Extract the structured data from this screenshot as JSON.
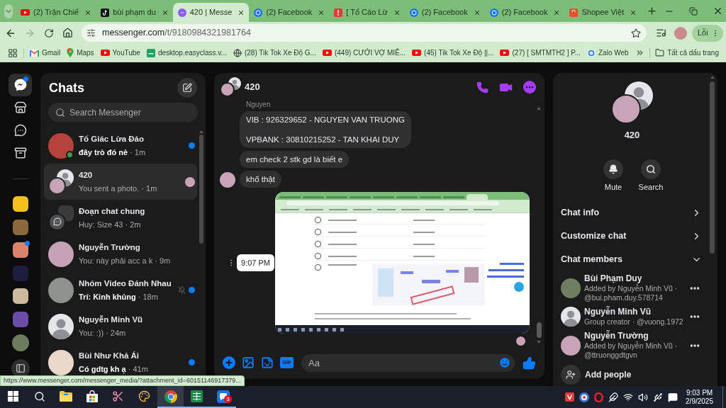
{
  "browser": {
    "tabs": [
      {
        "title": "(2) Trận Chiế",
        "kind": "youtube",
        "selected": false
      },
      {
        "title": "bùi phạm du",
        "kind": "tiktok",
        "selected": false
      },
      {
        "title": "420 | Messe",
        "kind": "messenger",
        "selected": true
      },
      {
        "title": "(2) Facebook",
        "kind": "facebook",
        "selected": false
      },
      {
        "title": "[ Tố Cáo Lừ",
        "kind": "report",
        "selected": false
      },
      {
        "title": "(2) Facebook",
        "kind": "facebook",
        "selected": false
      },
      {
        "title": "(2) Facebook",
        "kind": "facebook",
        "selected": false
      },
      {
        "title": "Shopee Việt",
        "kind": "shopee",
        "selected": false
      }
    ],
    "forward_disabled": true,
    "address": {
      "host": "messenger.com",
      "path": "/t/9180984321981764"
    },
    "profile_button": "Lỗi",
    "bookmarks": [
      {
        "label": "Gmail",
        "kind": "gmail"
      },
      {
        "label": "Maps",
        "kind": "maps"
      },
      {
        "label": "YouTube",
        "kind": "youtube"
      },
      {
        "label": "desktop.easyclass.v...",
        "kind": "easyclass"
      },
      {
        "label": "(28) Tik Tok Xe Độ G...",
        "kind": "globe"
      },
      {
        "label": "(449) CƯỚI VỢ MIỄ...",
        "kind": "youtube"
      },
      {
        "label": "(45) Tik Tok Xe Độ ||...",
        "kind": "youtube"
      },
      {
        "label": "(27) [ SMTMTH2 ] P...",
        "kind": "youtube"
      },
      {
        "label": "Zalo Web",
        "kind": "zalo"
      }
    ],
    "all_bookmarks": "Tất cả dấu trang"
  },
  "nav_rail": {
    "items": [
      {
        "kind": "chats",
        "selected": true,
        "unread": true
      },
      {
        "kind": "marketplace",
        "selected": false,
        "unread": false
      },
      {
        "kind": "requests",
        "selected": false,
        "unread": false
      },
      {
        "kind": "archive",
        "selected": false,
        "unread": false
      }
    ],
    "communities": [
      {
        "kind": "tile",
        "unread": false
      },
      {
        "kind": "tile",
        "unread": false
      },
      {
        "kind": "tile",
        "unread": true
      },
      {
        "kind": "tile",
        "unread": false
      },
      {
        "kind": "tile",
        "unread": false
      },
      {
        "kind": "tile",
        "unread": false
      },
      {
        "kind": "round",
        "unread": false
      }
    ]
  },
  "chats": {
    "title": "Chats",
    "search_placeholder": "Search Messenger",
    "items": [
      {
        "name": "Tố Giác Lừa Đảo",
        "preview": "đây trò đó nè",
        "time": "· 1m",
        "kind": "photo",
        "unread": true,
        "selected": false,
        "muted": false,
        "online": true,
        "seen": false
      },
      {
        "name": "420",
        "preview": "You sent a photo.",
        "time": "· 1m",
        "kind": "group",
        "unread": false,
        "selected": true,
        "muted": false,
        "online": false,
        "seen": true
      },
      {
        "name": "Đoạn chat chung",
        "preview": "Huy: Size 43",
        "time": "· 2m",
        "kind": "community",
        "unread": false,
        "selected": false,
        "muted": false,
        "online": false,
        "seen": false
      },
      {
        "name": "Nguyễn Trường",
        "preview": "You: này phải acc a k",
        "time": "· 9m",
        "kind": "photo",
        "unread": false,
        "selected": false,
        "muted": false,
        "online": false,
        "seen": false
      },
      {
        "name": "Nhóm Video Đánh Nhau",
        "preview": "Trí: Kinh khủng",
        "time": "· 18m",
        "kind": "photo",
        "unread": true,
        "selected": false,
        "muted": true,
        "online": false,
        "seen": false
      },
      {
        "name": "Nguyễn Minh Vũ",
        "preview": "You: :))",
        "time": "· 24m",
        "kind": "default",
        "unread": false,
        "selected": false,
        "muted": false,
        "online": false,
        "seen": false
      },
      {
        "name": "Bùi Như Khả Ái",
        "preview": "Có gdtg kh ạ",
        "time": "· 41m",
        "kind": "photo",
        "unread": true,
        "selected": false,
        "muted": false,
        "online": false,
        "seen": false
      }
    ]
  },
  "conversation": {
    "title": "420",
    "messages": [
      {
        "kind": "fragment",
        "text": "Nguyen"
      },
      {
        "kind": "text",
        "lines": [
          "VIB : 926329652 - NGUYEN VAN TRUONG",
          "VPBANK : 30810215252 - TAN KHAI DUY"
        ],
        "avatar": false
      },
      {
        "kind": "text",
        "lines": [
          "em check 2 stk gd là biết e"
        ],
        "avatar": false
      },
      {
        "kind": "text",
        "lines": [
          "khổ thật"
        ],
        "avatar": true
      },
      {
        "kind": "image",
        "time": "9:07 PM",
        "seen": true
      }
    ],
    "gif_label": "GIF",
    "composer_placeholder": "Aa"
  },
  "details": {
    "title": "420",
    "actions": [
      {
        "label": "Mute",
        "kind": "bell"
      },
      {
        "label": "Search",
        "kind": "search"
      }
    ],
    "sections": [
      {
        "label": "Chat info",
        "expanded": false
      },
      {
        "label": "Customize chat",
        "expanded": false
      },
      {
        "label": "Chat members",
        "expanded": true,
        "members": [
          {
            "name": "Bùi Phạm Duy",
            "detail": "Added by Nguyễn Minh Vũ · @bui.pham.duy.578714",
            "kind": "photo"
          },
          {
            "name": "Nguyễn Minh Vũ",
            "detail": "Group creator · @vuong.1972",
            "kind": "default"
          },
          {
            "name": "Nguyễn Trường",
            "detail": "Added by Nguyễn Minh Vũ · @ttruonggdtgvn",
            "kind": "photo"
          }
        ],
        "add_people": "Add people"
      }
    ]
  },
  "status_link": "https://www.messenger.com/messenger_media/?attachment_id=60151146917379...",
  "taskbar": {
    "apps": [
      {
        "kind": "start",
        "selected": false,
        "running": false
      },
      {
        "kind": "search",
        "selected": false,
        "running": false
      },
      {
        "kind": "explorer",
        "selected": false,
        "running": false
      },
      {
        "kind": "store",
        "selected": false,
        "running": false
      },
      {
        "kind": "scissors",
        "selected": false,
        "running": false
      },
      {
        "kind": "paint",
        "selected": false,
        "running": false
      },
      {
        "kind": "chrome",
        "selected": true,
        "running": true
      },
      {
        "kind": "sheet",
        "selected": false,
        "running": true
      },
      {
        "kind": "chat",
        "selected": false,
        "running": true,
        "badge": "3"
      }
    ],
    "clock": {
      "time": "9:03 PM",
      "date": "2/9/2025"
    }
  }
}
